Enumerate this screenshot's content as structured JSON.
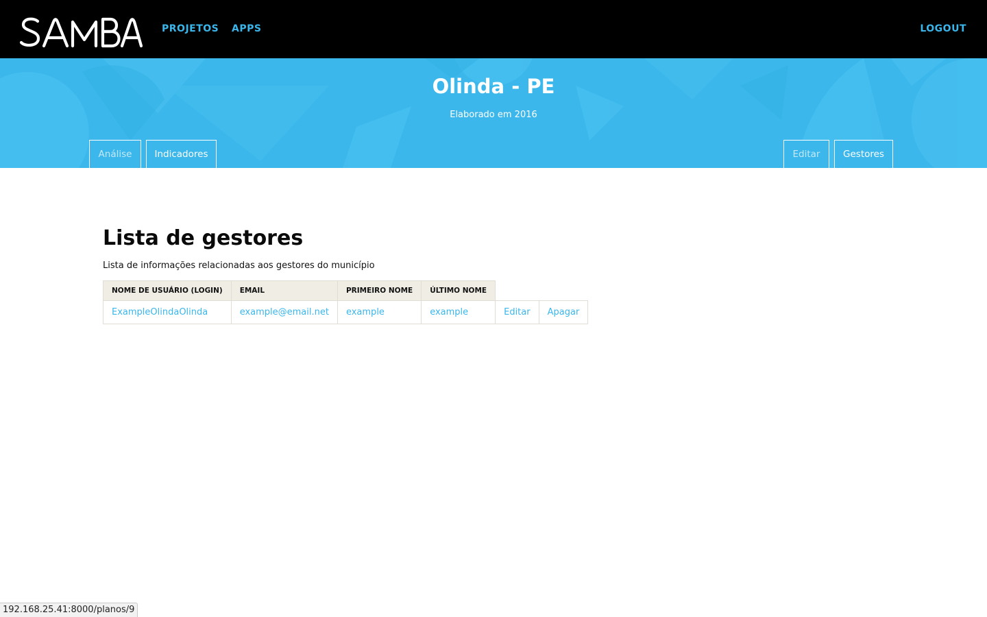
{
  "header": {
    "logo_text": "SAMBA",
    "nav": {
      "projetos": "PROJETOS",
      "apps": "APPS",
      "logout": "LOGOUT"
    }
  },
  "banner": {
    "title": "Olinda - PE",
    "subtitle": "Elaborado em 2016",
    "tabs": {
      "analise": "Análise",
      "indicadores": "Indicadores",
      "editar": "Editar",
      "gestores": "Gestores"
    }
  },
  "main": {
    "title": "Lista de gestores",
    "description": "Lista de informações relacionadas aos gestores do município",
    "table": {
      "headers": [
        "NOME DE USUÁRIO (LOGIN)",
        "EMAIL",
        "PRIMEIRO NOME",
        "ÚLTIMO NOME"
      ],
      "rows": [
        {
          "login": "ExampleOlindaOlinda",
          "email": "example@email.net",
          "first_name": "example",
          "last_name": "example",
          "edit_label": "Editar",
          "delete_label": "Apagar"
        }
      ]
    }
  },
  "status_bar": {
    "url": "192.168.25.41:8000/planos/9"
  },
  "colors": {
    "accent": "#3ab6ea",
    "banner": "#3bb7eb",
    "topbar": "#000000",
    "table_header": "#f0ede5"
  }
}
